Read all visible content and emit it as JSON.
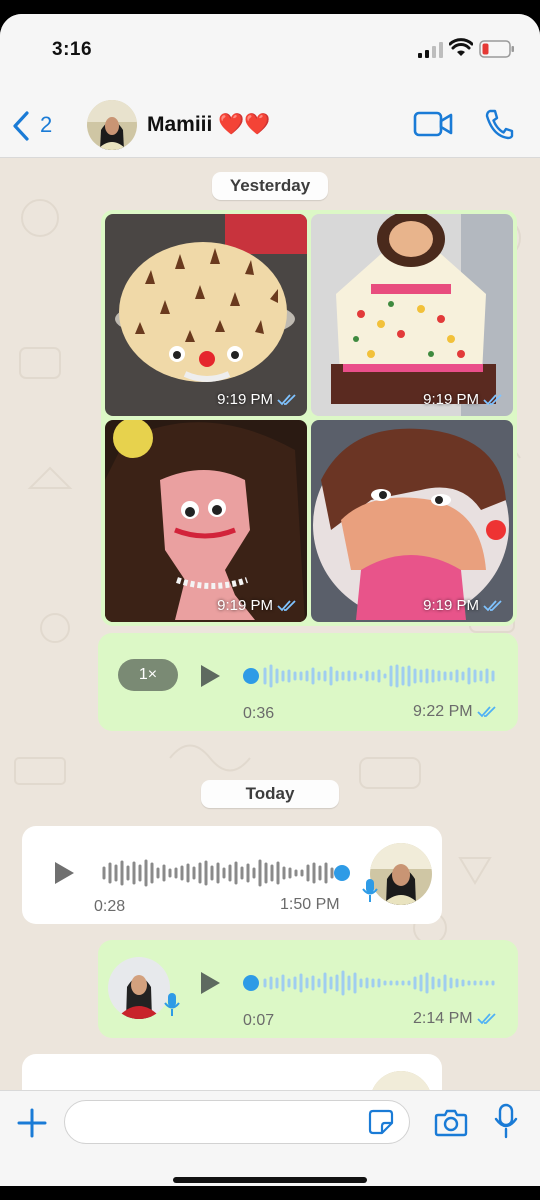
{
  "status": {
    "time": "3:16"
  },
  "header": {
    "back_count": "2",
    "contact_name": "Mamiii ❤️❤️"
  },
  "chat": {
    "date_yesterday": "Yesterday",
    "date_today": "Today",
    "photos": [
      {
        "time": "9:19 PM"
      },
      {
        "time": "9:19 PM"
      },
      {
        "time": "9:19 PM"
      },
      {
        "time": "9:19 PM"
      }
    ],
    "voice_1": {
      "speed": "1×",
      "duration": "0:36",
      "time": "9:22 PM"
    },
    "voice_2": {
      "duration": "0:28",
      "time": "1:50 PM"
    },
    "voice_3": {
      "duration": "0:07",
      "time": "2:14 PM"
    }
  },
  "input": {
    "placeholder": ""
  },
  "colors": {
    "accent": "#1a7bd6",
    "outgoing_bubble": "#dcf8c6",
    "incoming_bubble": "#ffffff",
    "chat_bg": "#ece5dc"
  },
  "icons": [
    "chevron-left-icon",
    "video-camera-icon",
    "phone-icon",
    "play-icon",
    "mic-icon",
    "plus-icon",
    "sticker-icon",
    "camera-icon",
    "double-check-icon"
  ]
}
